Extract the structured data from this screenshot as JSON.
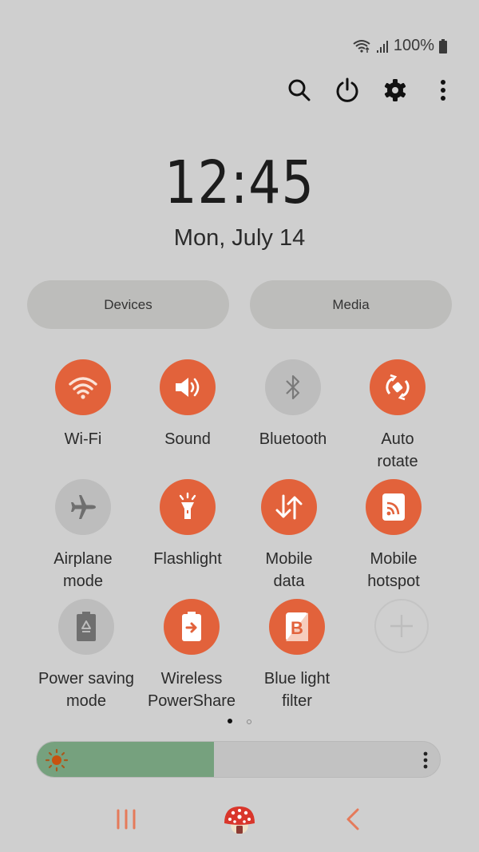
{
  "status_bar": {
    "icons": [
      "wifi-icon",
      "signal-icon",
      "battery-icon"
    ],
    "battery_text": "100%"
  },
  "top_actions": {
    "icons": [
      "search-icon",
      "power-icon",
      "gear-icon",
      "more-vertical-icon"
    ]
  },
  "clock": {
    "time": "12:45",
    "date": "Mon, July 14"
  },
  "pills": [
    {
      "label": "Devices"
    },
    {
      "label": "Media"
    }
  ],
  "tiles": [
    {
      "label": "Wi-Fi",
      "icon": "wifi-icon",
      "state": "on"
    },
    {
      "label": "Sound",
      "icon": "speaker-icon",
      "state": "on"
    },
    {
      "label": "Bluetooth",
      "icon": "bluetooth-icon",
      "state": "off"
    },
    {
      "label": "Auto\nrotate",
      "icon": "auto-rotate-icon",
      "state": "on"
    },
    {
      "label": "Airplane\nmode",
      "icon": "airplane-icon",
      "state": "off"
    },
    {
      "label": "Flashlight",
      "icon": "flashlight-icon",
      "state": "on"
    },
    {
      "label": "Mobile\ndata",
      "icon": "mobile-data-icon",
      "state": "on"
    },
    {
      "label": "Mobile\nhotspot",
      "icon": "hotspot-icon",
      "state": "on"
    },
    {
      "label": "Power saving\nmode",
      "icon": "power-saving-icon",
      "state": "off"
    },
    {
      "label": "Wireless\nPowerShare",
      "icon": "wireless-powershare-icon",
      "state": "on"
    },
    {
      "label": "Blue light\nfilter",
      "icon": "blue-light-filter-icon",
      "state": "on"
    },
    {
      "label": "",
      "icon": "add-icon",
      "state": "add"
    }
  ],
  "page_indicator": {
    "current": 1,
    "total": 2
  },
  "brightness": {
    "level": 0.44,
    "icon": "sun-icon",
    "menu_icon": "more-vertical-icon"
  },
  "navbar": {
    "icons": [
      "recent-apps-icon",
      "home-mushroom-icon",
      "back-icon"
    ]
  },
  "colors": {
    "accent": "#e2623b",
    "tile_off": "#bdbdbd",
    "background": "#cfcfcf",
    "brightness_fill": "#76a17e",
    "nav": "#e57a5a"
  }
}
